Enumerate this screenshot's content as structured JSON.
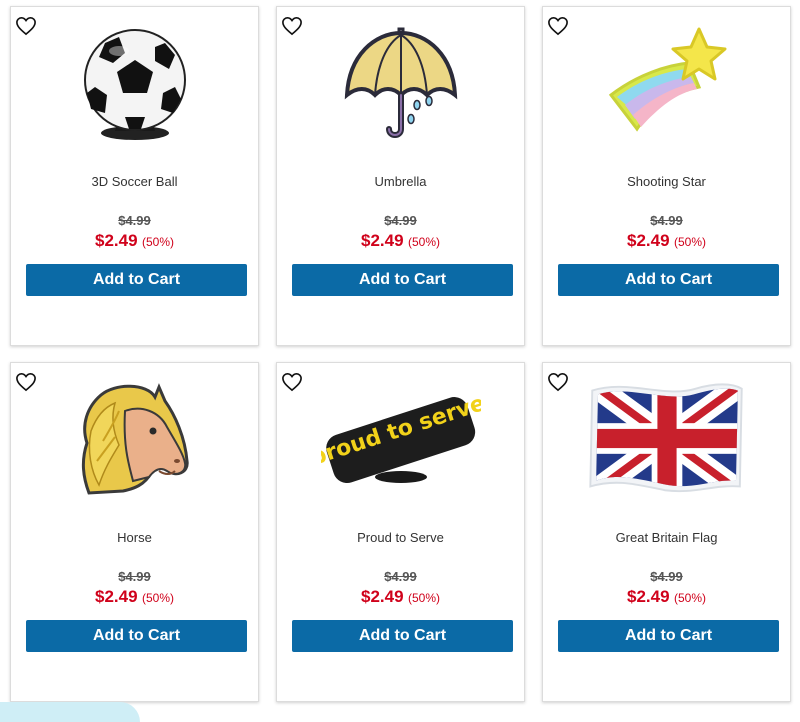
{
  "products": [
    {
      "name": "3D Soccer Ball",
      "original_price": "$4.99",
      "sale_price": "$2.49",
      "discount": "(50%)",
      "add_label": "Add to Cart",
      "icon": "soccer-ball-icon"
    },
    {
      "name": "Umbrella",
      "original_price": "$4.99",
      "sale_price": "$2.49",
      "discount": "(50%)",
      "add_label": "Add to Cart",
      "icon": "umbrella-icon"
    },
    {
      "name": "Shooting Star",
      "original_price": "$4.99",
      "sale_price": "$2.49",
      "discount": "(50%)",
      "add_label": "Add to Cart",
      "icon": "shooting-star-icon"
    },
    {
      "name": "Horse",
      "original_price": "$4.99",
      "sale_price": "$2.49",
      "discount": "(50%)",
      "add_label": "Add to Cart",
      "icon": "horse-icon"
    },
    {
      "name": "Proud to Serve",
      "original_price": "$4.99",
      "sale_price": "$2.49",
      "discount": "(50%)",
      "add_label": "Add to Cart",
      "icon": "proud-to-serve-icon",
      "image_text": "proud to serve"
    },
    {
      "name": "Great Britain Flag",
      "original_price": "$4.99",
      "sale_price": "$2.49",
      "discount": "(50%)",
      "add_label": "Add to Cart",
      "icon": "great-britain-flag-icon"
    }
  ],
  "colors": {
    "button": "#0b6aa6",
    "sale": "#d0021b",
    "strike": "#555555"
  }
}
